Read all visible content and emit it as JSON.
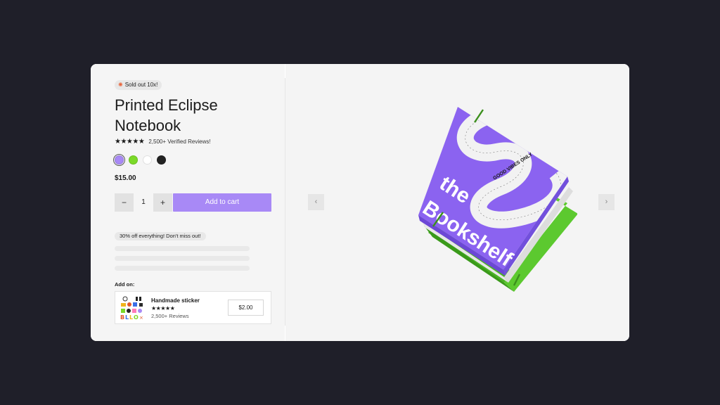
{
  "product": {
    "badge_text": "Sold out 10x!",
    "title": "Printed Eclipse Notebook",
    "rating_stars": "★★★★★",
    "reviews_text": "2,500+ Verified Reviews!",
    "price": "$15.00",
    "colors": [
      {
        "name": "purple",
        "hex": "#a889f6",
        "selected": true
      },
      {
        "name": "green",
        "hex": "#7bd928",
        "selected": false
      },
      {
        "name": "white",
        "hex": "#ffffff",
        "selected": false
      },
      {
        "name": "black",
        "hex": "#222222",
        "selected": false
      }
    ]
  },
  "cart": {
    "decrement_label": "−",
    "quantity": "1",
    "increment_label": "+",
    "add_to_cart_label": "Add to cart"
  },
  "promo": {
    "text": "30% off everything! Don't miss out!"
  },
  "addon": {
    "section_label": "Add on:",
    "name": "Handmade sticker",
    "stars": "★★★★★",
    "reviews": "2,500+ Reviews",
    "price": "$2.00"
  },
  "gallery": {
    "prev_icon": "chevron-left-icon",
    "next_icon": "chevron-right-icon",
    "prev_glyph": "‹",
    "next_glyph": "›",
    "cover_text_line1": "the",
    "cover_text_line2": "Bookshelf",
    "ribbon_text": "GOOD VIBES ONLY"
  },
  "colors": {
    "page_bg": "#1f1f29",
    "accent": "#a889f6",
    "book_purple": "#8b63f0",
    "book_green": "#5cc92f"
  }
}
